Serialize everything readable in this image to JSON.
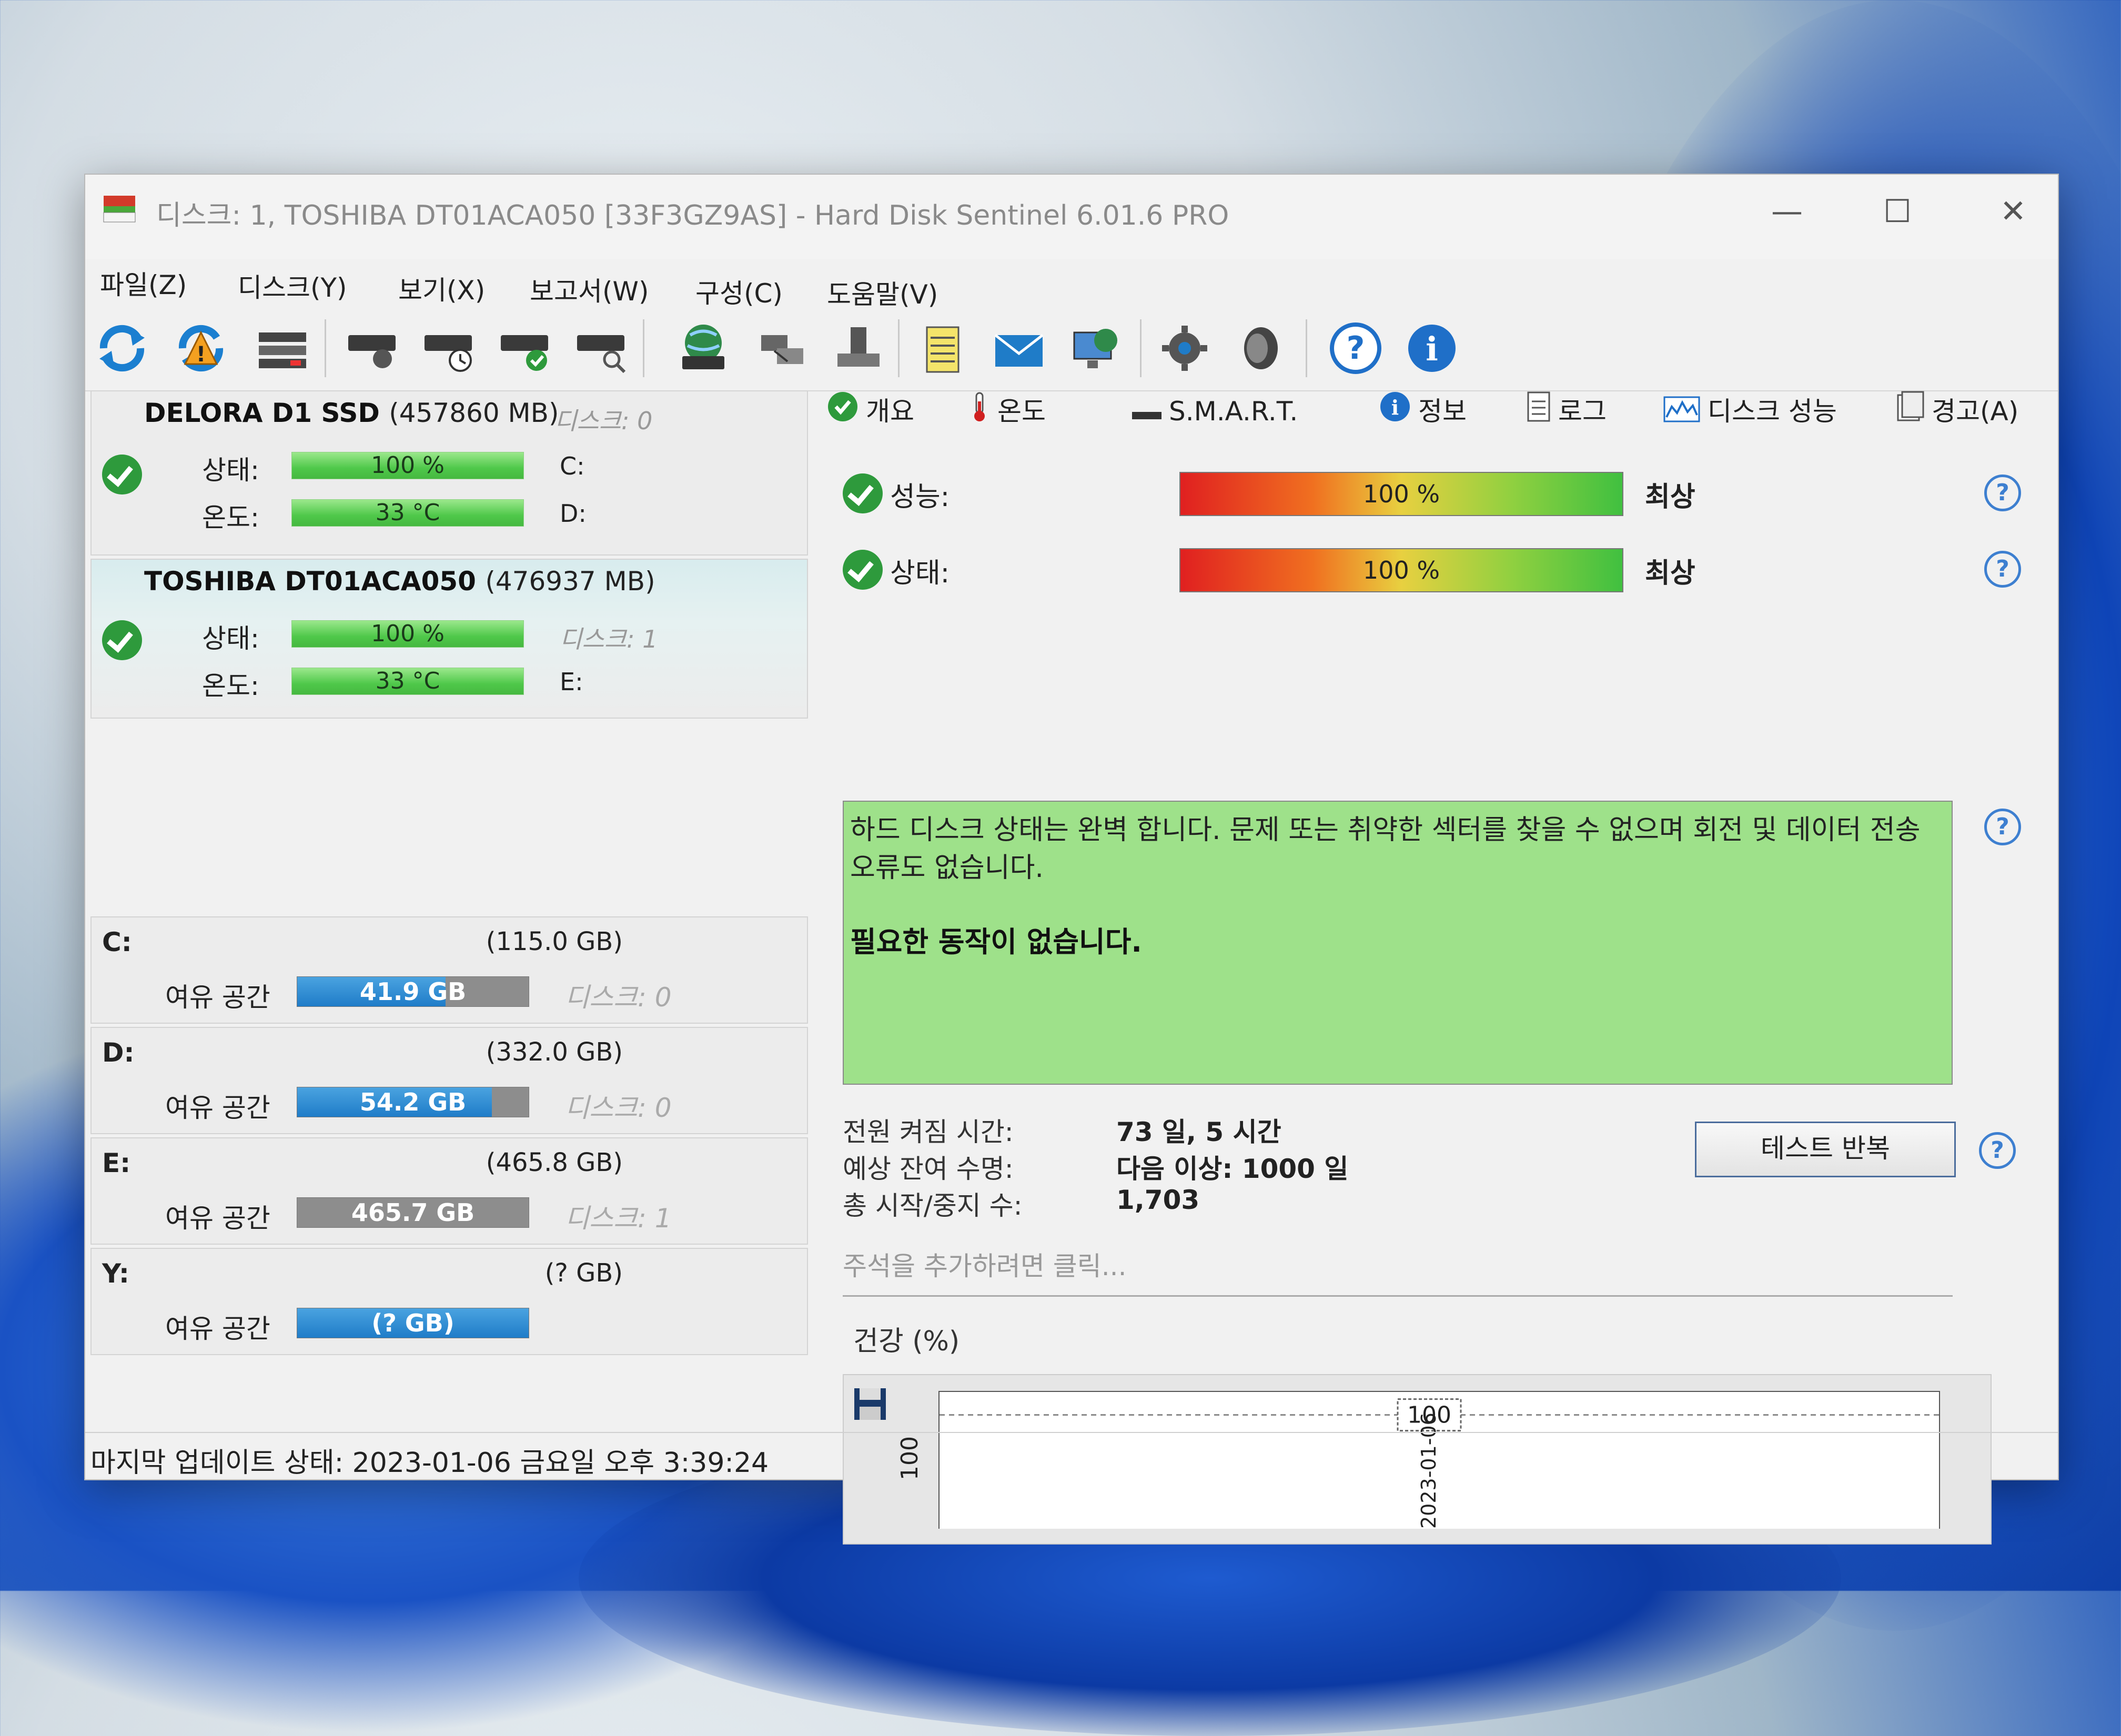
{
  "window": {
    "title": "디스크: 1, TOSHIBA DT01ACA050 [33F3GZ9AS]  -  Hard Disk Sentinel 6.01.6 PRO",
    "controls": {
      "minimize": "—",
      "maximize": "☐",
      "close": "✕"
    }
  },
  "menu": [
    "파일(Z)",
    "디스크(Y)",
    "보기(X)",
    "보고서(W)",
    "구성(C)",
    "도움말(V)"
  ],
  "toolbar": {
    "icons": [
      "refresh-icon",
      "refresh-warning-icon",
      "disk-list-icon",
      "disk-check-icon",
      "disk-clock-icon",
      "disk-ok-icon",
      "disk-search-icon",
      "globe-disk-icon",
      "network-icon",
      "usb-drive-icon",
      "notepad-icon",
      "mail-icon",
      "computer-globe-icon",
      "gear-icon",
      "speaker-icon",
      "help-icon",
      "info-icon"
    ]
  },
  "disks": [
    {
      "name": "DELORA D1 SSD",
      "size": "(457860 MB)",
      "disk_label": "디스크: 0",
      "status_label": "상태:",
      "status_value": "100 %",
      "status_fraction": 1.0,
      "temp_label": "온도:",
      "temp_value": "33 °C",
      "vol1": "C:",
      "vol2": "D:"
    },
    {
      "name": "TOSHIBA DT01ACA050",
      "size": "(476937 MB)",
      "disk_label": "디스크: 1",
      "status_label": "상태:",
      "status_value": "100 %",
      "status_fraction": 1.0,
      "temp_label": "온도:",
      "temp_value": "33 °C",
      "vol1": "E:"
    }
  ],
  "volumes": [
    {
      "drive": "C:",
      "size": "(115.0 GB)",
      "free_label": "여유 공간",
      "free": "41.9 GB",
      "used_fraction": 0.64,
      "disk": "디스크: 0"
    },
    {
      "drive": "D:",
      "size": "(332.0 GB)",
      "free_label": "여유 공간",
      "free": "54.2 GB",
      "used_fraction": 0.84,
      "disk": "디스크: 0"
    },
    {
      "drive": "E:",
      "size": "(465.8 GB)",
      "free_label": "여유 공간",
      "free": "465.7 GB",
      "used_fraction": 0.0,
      "disk": "디스크: 1"
    },
    {
      "drive": "Y:",
      "size": "(? GB)",
      "free_label": "여유 공간",
      "free": "(? GB)",
      "used_fraction": 1.0,
      "disk": ""
    }
  ],
  "tabs": [
    "개요",
    "온도",
    "S.M.A.R.T.",
    "정보",
    "로그",
    "디스크 성능",
    "경고(A)"
  ],
  "overview": {
    "performance_label": "성능:",
    "performance_value": "100 %",
    "performance_rating": "최상",
    "health_label": "상태:",
    "health_value": "100 %",
    "health_rating": "최상",
    "status_message": "하드 디스크 상태는 완벽 합니다. 문제 또는 취약한 섹터를 찾을 수 없으며 회전 및 데이터 전송 오류도 없습니다.",
    "action_message": "필요한 동작이 없습니다.",
    "power_on_label": "전원 켜짐 시간:",
    "power_on_value": "73 일, 5 시간",
    "lifetime_label": "예상 잔여 수명:",
    "lifetime_value": "다음 이상: 1000 일",
    "start_stop_label": "총 시작/중지 수:",
    "start_stop_value": "1,703",
    "retest_button": "테스트 반복",
    "note_placeholder": "주석을 추가하려면 클릭...",
    "health_chart_title": "건강 (%)"
  },
  "chart_data": {
    "type": "line",
    "title": "건강 (%)",
    "x": [
      "2023-01-06"
    ],
    "x_tick_label": "2023-01-06",
    "y_tick_label": "100",
    "values": [
      100
    ],
    "data_label": "100"
  },
  "statusbar": {
    "text": "마지막 업데이트 상태: 2023-01-06 금요일 오후 3:39:24"
  }
}
